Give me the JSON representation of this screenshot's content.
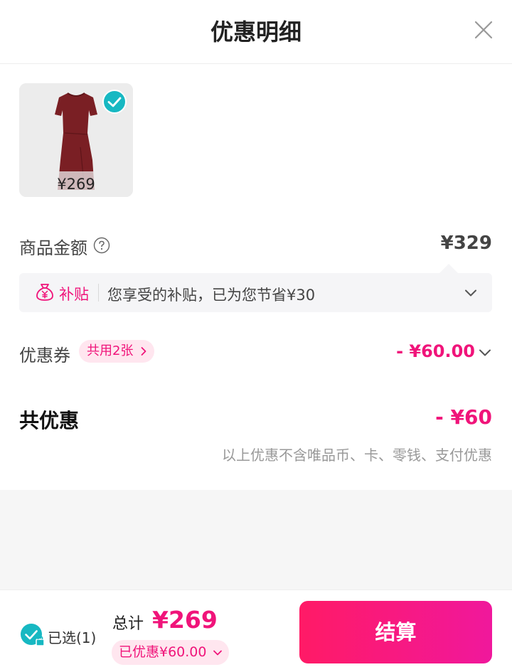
{
  "header": {
    "title": "优惠明细"
  },
  "product": {
    "price": "¥269",
    "selected": true
  },
  "amount": {
    "label": "商品金额",
    "value": "¥329"
  },
  "subsidy": {
    "tag": "补贴",
    "text": "您享受的补贴，已为您节省¥30"
  },
  "coupon": {
    "label": "优惠券",
    "badge": "共用2张",
    "value": "- ¥60.00"
  },
  "total": {
    "label": "共优惠",
    "value": "- ¥60",
    "note": "以上优惠不含唯品币、卡、零钱、支付优惠"
  },
  "footer": {
    "selected_label": "已选(1)",
    "sum_label": "总计",
    "sum_value": "¥269",
    "discount": "已优惠¥60.00",
    "checkout_label": "结算"
  },
  "colors": {
    "accent": "#f0147a",
    "check": "#17b8c2",
    "grey_bg": "#f6f6f6"
  }
}
